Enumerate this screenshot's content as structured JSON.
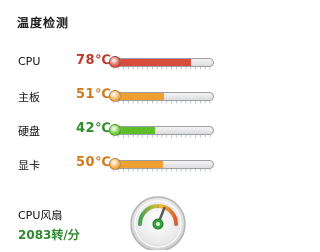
{
  "panel": {
    "title": "温度检测",
    "sensors": [
      {
        "label": "CPU",
        "value": "78℃",
        "level": 0.78,
        "value_color": "#c0392b",
        "bar_color": "#d94c3d",
        "knob_color": "#e0574a"
      },
      {
        "label": "主板",
        "value": "51℃",
        "level": 0.51,
        "value_color": "#d07a1a",
        "bar_color": "#f0a030",
        "knob_color": "#f3b04a"
      },
      {
        "label": "硬盘",
        "value": "42℃",
        "level": 0.42,
        "value_color": "#2e8b2e",
        "bar_color": "#5cbf2a",
        "knob_color": "#6fd03a"
      },
      {
        "label": "显卡",
        "value": "50℃",
        "level": 0.5,
        "value_color": "#d07a1a",
        "bar_color": "#f0a030",
        "knob_color": "#f3b04a"
      }
    ],
    "fan": {
      "label": "CPU风扇",
      "speed": "2083转/分",
      "dial_level": 0.62,
      "dial_icon": "fan-dial-icon"
    }
  }
}
